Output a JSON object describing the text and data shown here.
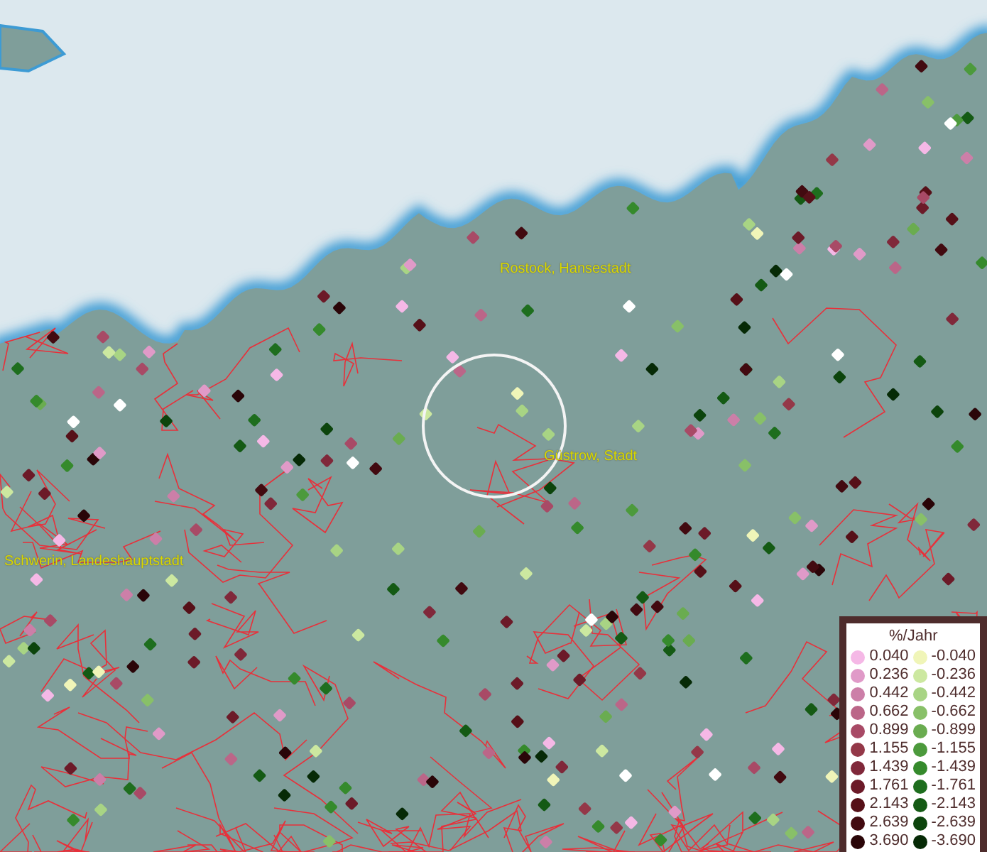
{
  "map": {
    "places": [
      {
        "name": "Rostock, Hansestadt"
      },
      {
        "name": "Güstrow, Stadt"
      },
      {
        "name": "Schwerin, Landeshauptstadt"
      }
    ],
    "legend": {
      "title": "%/Jahr",
      "positive": [
        {
          "label": "0.040",
          "color": "#f5b8e6"
        },
        {
          "label": "0.236",
          "color": "#e09ac8"
        },
        {
          "label": "0.442",
          "color": "#cc7fa8"
        },
        {
          "label": "0.662",
          "color": "#bb6688"
        },
        {
          "label": "0.899",
          "color": "#a84a66"
        },
        {
          "label": "1.155",
          "color": "#943848"
        },
        {
          "label": "1.439",
          "color": "#80283a"
        },
        {
          "label": "1.761",
          "color": "#6c1a28"
        },
        {
          "label": "2.143",
          "color": "#561018"
        },
        {
          "label": "2.639",
          "color": "#420a10"
        },
        {
          "label": "3.690",
          "color": "#2a0508"
        }
      ],
      "negative": [
        {
          "label": "-0.040",
          "color": "#f0f5b8"
        },
        {
          "label": "-0.236",
          "color": "#cce8a0"
        },
        {
          "label": "-0.442",
          "color": "#a8d484"
        },
        {
          "label": "-0.662",
          "color": "#88c068"
        },
        {
          "label": "-0.899",
          "color": "#6aac50"
        },
        {
          "label": "-1.155",
          "color": "#4c9a3c"
        },
        {
          "label": "-1.439",
          "color": "#358a2c"
        },
        {
          "label": "-1.761",
          "color": "#1e6e1e"
        },
        {
          "label": "-2.143",
          "color": "#145a14"
        },
        {
          "label": "-2.639",
          "color": "#0c440c"
        },
        {
          "label": "-3.690",
          "color": "#062a06"
        }
      ]
    }
  }
}
